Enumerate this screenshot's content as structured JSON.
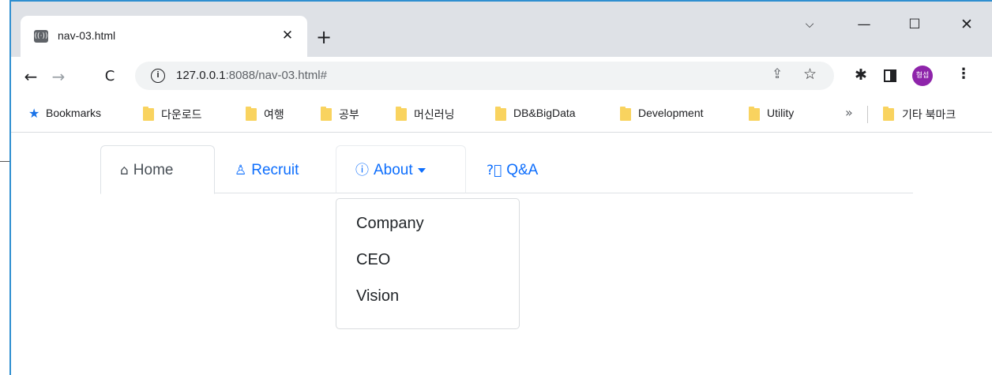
{
  "browser": {
    "tab_title": "nav-03.html",
    "tab_close": "✕",
    "new_tab": "+",
    "window_controls": {
      "dropdown": "⌵",
      "minimize": "—",
      "maximize": "☐",
      "close": "✕"
    },
    "toolbar": {
      "back": "←",
      "forward": "→",
      "reload": "C",
      "url_host": "127.0.0.1",
      "url_path": ":8088/nav-03.html#",
      "avatar_text": "형섭"
    },
    "bookmarks": {
      "star_label": "Bookmarks",
      "items": [
        "다운로드",
        "여행",
        "공부",
        "머신러닝",
        "DB&BigData",
        "Development",
        "Utility"
      ],
      "more": "»",
      "other": "기타 북마크"
    }
  },
  "nav": {
    "home": {
      "label": "Home",
      "icon": "house-icon"
    },
    "recruit": {
      "label": "Recruit",
      "icon": "person-icon"
    },
    "about": {
      "label": "About",
      "icon": "info-circle-icon"
    },
    "qa": {
      "label": "Q&A",
      "icon": "question-circle-icon"
    }
  },
  "dropdown": {
    "items": [
      "Company",
      "CEO",
      "Vision"
    ]
  },
  "colors": {
    "link": "#0d6efd",
    "active_text": "#495057",
    "border": "#dee2e6",
    "tabstrip": "#dee1e6",
    "avatar": "#8e24aa"
  }
}
